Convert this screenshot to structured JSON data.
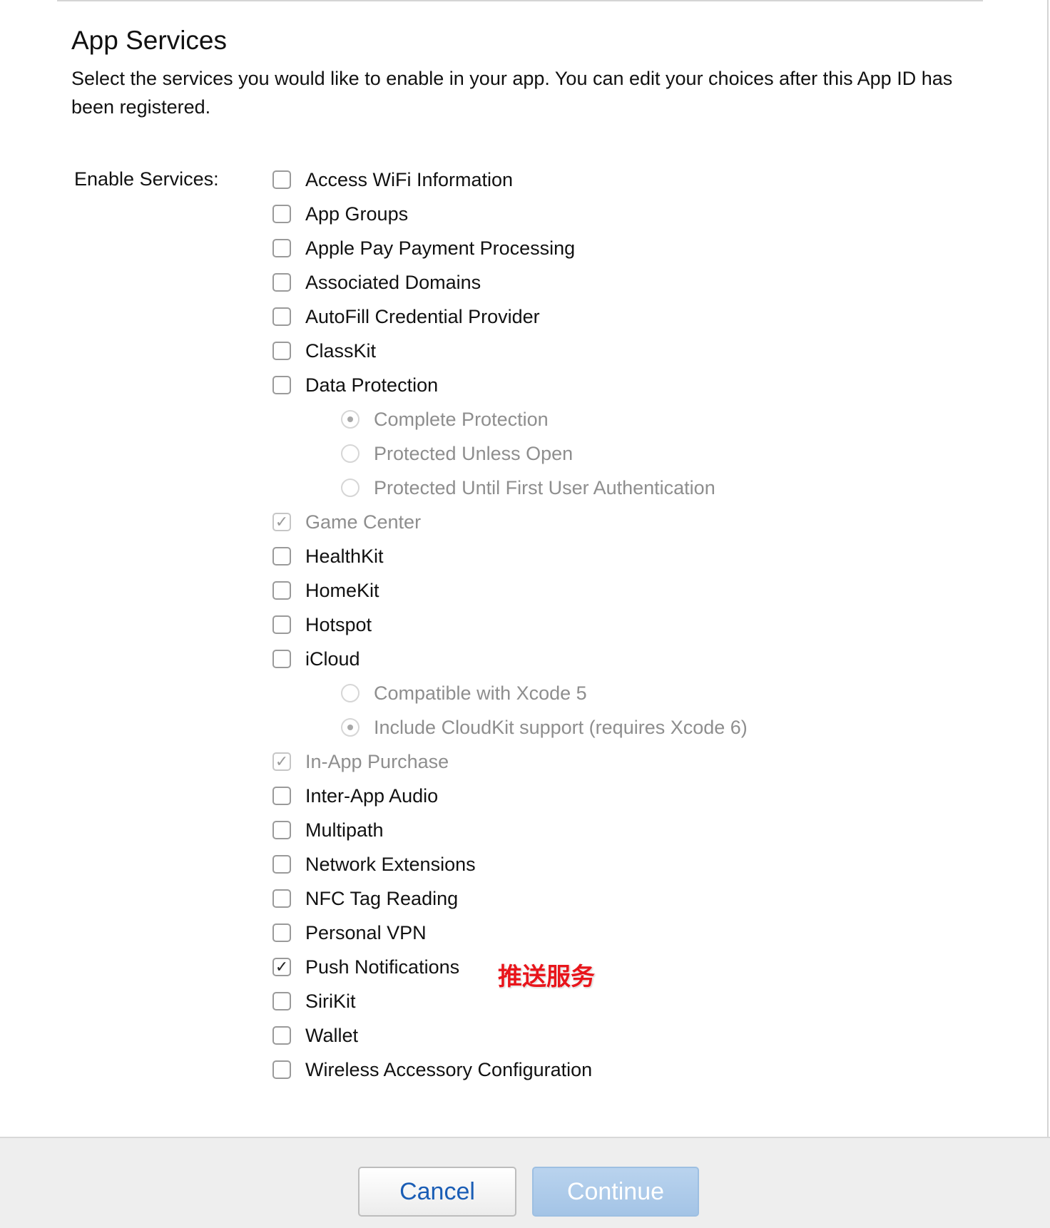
{
  "section": {
    "title": "App Services",
    "description": "Select the services you would like to enable in your app. You can edit your choices after this App ID has been registered."
  },
  "enable_label": "Enable Services:",
  "services": [
    {
      "label": "Access WiFi Information",
      "type": "checkbox",
      "checked": false,
      "disabled": false
    },
    {
      "label": "App Groups",
      "type": "checkbox",
      "checked": false,
      "disabled": false
    },
    {
      "label": "Apple Pay Payment Processing",
      "type": "checkbox",
      "checked": false,
      "disabled": false
    },
    {
      "label": "Associated Domains",
      "type": "checkbox",
      "checked": false,
      "disabled": false
    },
    {
      "label": "AutoFill Credential Provider",
      "type": "checkbox",
      "checked": false,
      "disabled": false
    },
    {
      "label": "ClassKit",
      "type": "checkbox",
      "checked": false,
      "disabled": false
    },
    {
      "label": "Data Protection",
      "type": "checkbox",
      "checked": false,
      "disabled": false
    },
    {
      "label": "Complete Protection",
      "type": "radio",
      "checked": true,
      "disabled": true
    },
    {
      "label": "Protected Unless Open",
      "type": "radio",
      "checked": false,
      "disabled": true
    },
    {
      "label": "Protected Until First User Authentication",
      "type": "radio",
      "checked": false,
      "disabled": true
    },
    {
      "label": "Game Center",
      "type": "checkbox",
      "checked": true,
      "disabled": true
    },
    {
      "label": "HealthKit",
      "type": "checkbox",
      "checked": false,
      "disabled": false
    },
    {
      "label": "HomeKit",
      "type": "checkbox",
      "checked": false,
      "disabled": false
    },
    {
      "label": "Hotspot",
      "type": "checkbox",
      "checked": false,
      "disabled": false
    },
    {
      "label": "iCloud",
      "type": "checkbox",
      "checked": false,
      "disabled": false
    },
    {
      "label": "Compatible with Xcode 5",
      "type": "radio",
      "checked": false,
      "disabled": true
    },
    {
      "label": "Include CloudKit support (requires Xcode 6)",
      "type": "radio",
      "checked": true,
      "disabled": true
    },
    {
      "label": "In-App Purchase",
      "type": "checkbox",
      "checked": true,
      "disabled": true
    },
    {
      "label": "Inter-App Audio",
      "type": "checkbox",
      "checked": false,
      "disabled": false
    },
    {
      "label": "Multipath",
      "type": "checkbox",
      "checked": false,
      "disabled": false
    },
    {
      "label": "Network Extensions",
      "type": "checkbox",
      "checked": false,
      "disabled": false
    },
    {
      "label": "NFC Tag Reading",
      "type": "checkbox",
      "checked": false,
      "disabled": false
    },
    {
      "label": "Personal VPN",
      "type": "checkbox",
      "checked": false,
      "disabled": false
    },
    {
      "label": "Push Notifications",
      "type": "checkbox",
      "checked": true,
      "disabled": false
    },
    {
      "label": "SiriKit",
      "type": "checkbox",
      "checked": false,
      "disabled": false
    },
    {
      "label": "Wallet",
      "type": "checkbox",
      "checked": false,
      "disabled": false
    },
    {
      "label": "Wireless Accessory Configuration",
      "type": "checkbox",
      "checked": false,
      "disabled": false
    }
  ],
  "annotation": {
    "text": "推送服务",
    "color": "#e8151b"
  },
  "footer": {
    "cancel_label": "Cancel",
    "continue_label": "Continue"
  },
  "colors": {
    "link_blue": "#1a5db5",
    "continue_disabled": "#a4c4e6",
    "footer_bg": "#eeeeee"
  }
}
